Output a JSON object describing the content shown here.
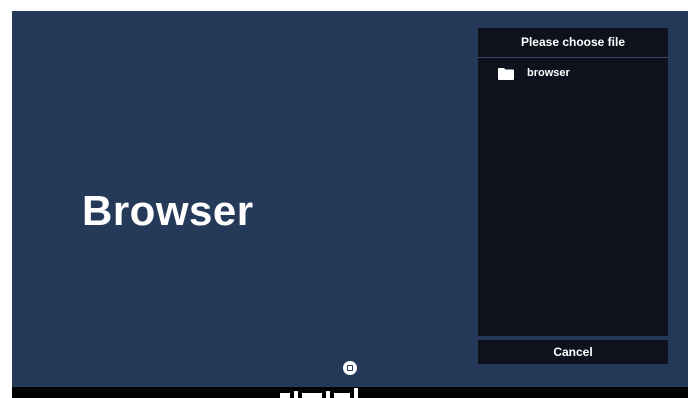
{
  "app": {
    "title": "Browser"
  },
  "file_dialog": {
    "title": "Please choose file",
    "items": [
      {
        "name": "browser",
        "icon": "folder-icon"
      }
    ],
    "cancel_label": "Cancel"
  },
  "nav": {
    "home_icon": "home-icon"
  },
  "colors": {
    "background": "#253a59",
    "dialog_background": "#0d121d",
    "text": "#ffffff",
    "bottom_bar": "#000000"
  }
}
